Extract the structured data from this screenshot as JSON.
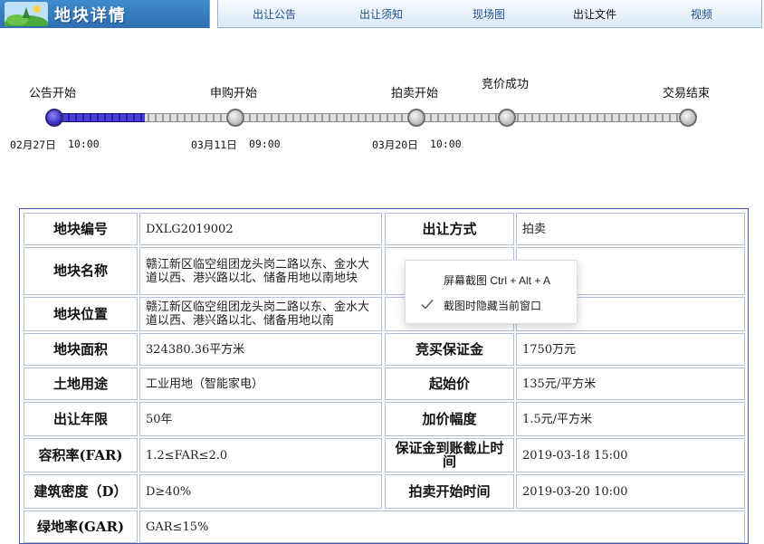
{
  "header": {
    "title": "地块详情",
    "tabs": [
      {
        "label": "出让公告"
      },
      {
        "label": "出让须知"
      },
      {
        "label": "现场图"
      },
      {
        "label": "出让文件"
      },
      {
        "label": "视频"
      }
    ]
  },
  "timeline": {
    "stages": [
      {
        "label": "公告开始",
        "date": "02月27日",
        "time": "10:00"
      },
      {
        "label": "申购开始",
        "date": "03月11日",
        "time": "09:00"
      },
      {
        "label": "拍卖开始",
        "date": "03月20日",
        "time": "10:00"
      },
      {
        "label": "竞价成功"
      },
      {
        "label": "交易结束"
      }
    ],
    "progress_fraction": 0.143
  },
  "table": {
    "rows": [
      {
        "label1": "地块编号",
        "value1": "DXLG2019002",
        "label2": "出让方式",
        "value2": "拍卖"
      },
      {
        "label1": "地块名称",
        "value1": "赣江新区临空组团龙头岗二路以东、金水大道以西、港兴路以北、储备用地以南地块",
        "label2": "",
        "value2": ""
      },
      {
        "label1": "地块位置",
        "value1": "赣江新区临空组团龙头岗二路以东、金水大道以西、港兴路以北、储备用地以南",
        "label2": "",
        "value2": ""
      },
      {
        "label1": "地块面积",
        "value1": "324380.36平方米",
        "label2": "竞买保证金",
        "value2": "1750万元"
      },
      {
        "label1": "土地用途",
        "value1": "工业用地（智能家电）",
        "label2": "起始价",
        "value2": "135元/平方米"
      },
      {
        "label1": "出让年限",
        "value1": "50年",
        "label2": "加价幅度",
        "value2": "1.5元/平方米"
      },
      {
        "label1": "容积率(FAR)",
        "value1": "1.2≤FAR≤2.0",
        "label2": "保证金到账截止时间",
        "value2": "2019-03-18 15:00"
      },
      {
        "label1": "建筑密度（D）",
        "value1": "D≥40%",
        "label2": "拍卖开始时间",
        "value2": "2019-03-20 10:00"
      },
      {
        "label1": "绿地率(GAR)",
        "value1": "GAR≤15%"
      }
    ]
  },
  "context_menu": {
    "items": [
      {
        "label": "屏幕截图 Ctrl + Alt + A",
        "checked": false
      },
      {
        "label": "截图时隐藏当前窗口",
        "checked": true
      }
    ]
  }
}
